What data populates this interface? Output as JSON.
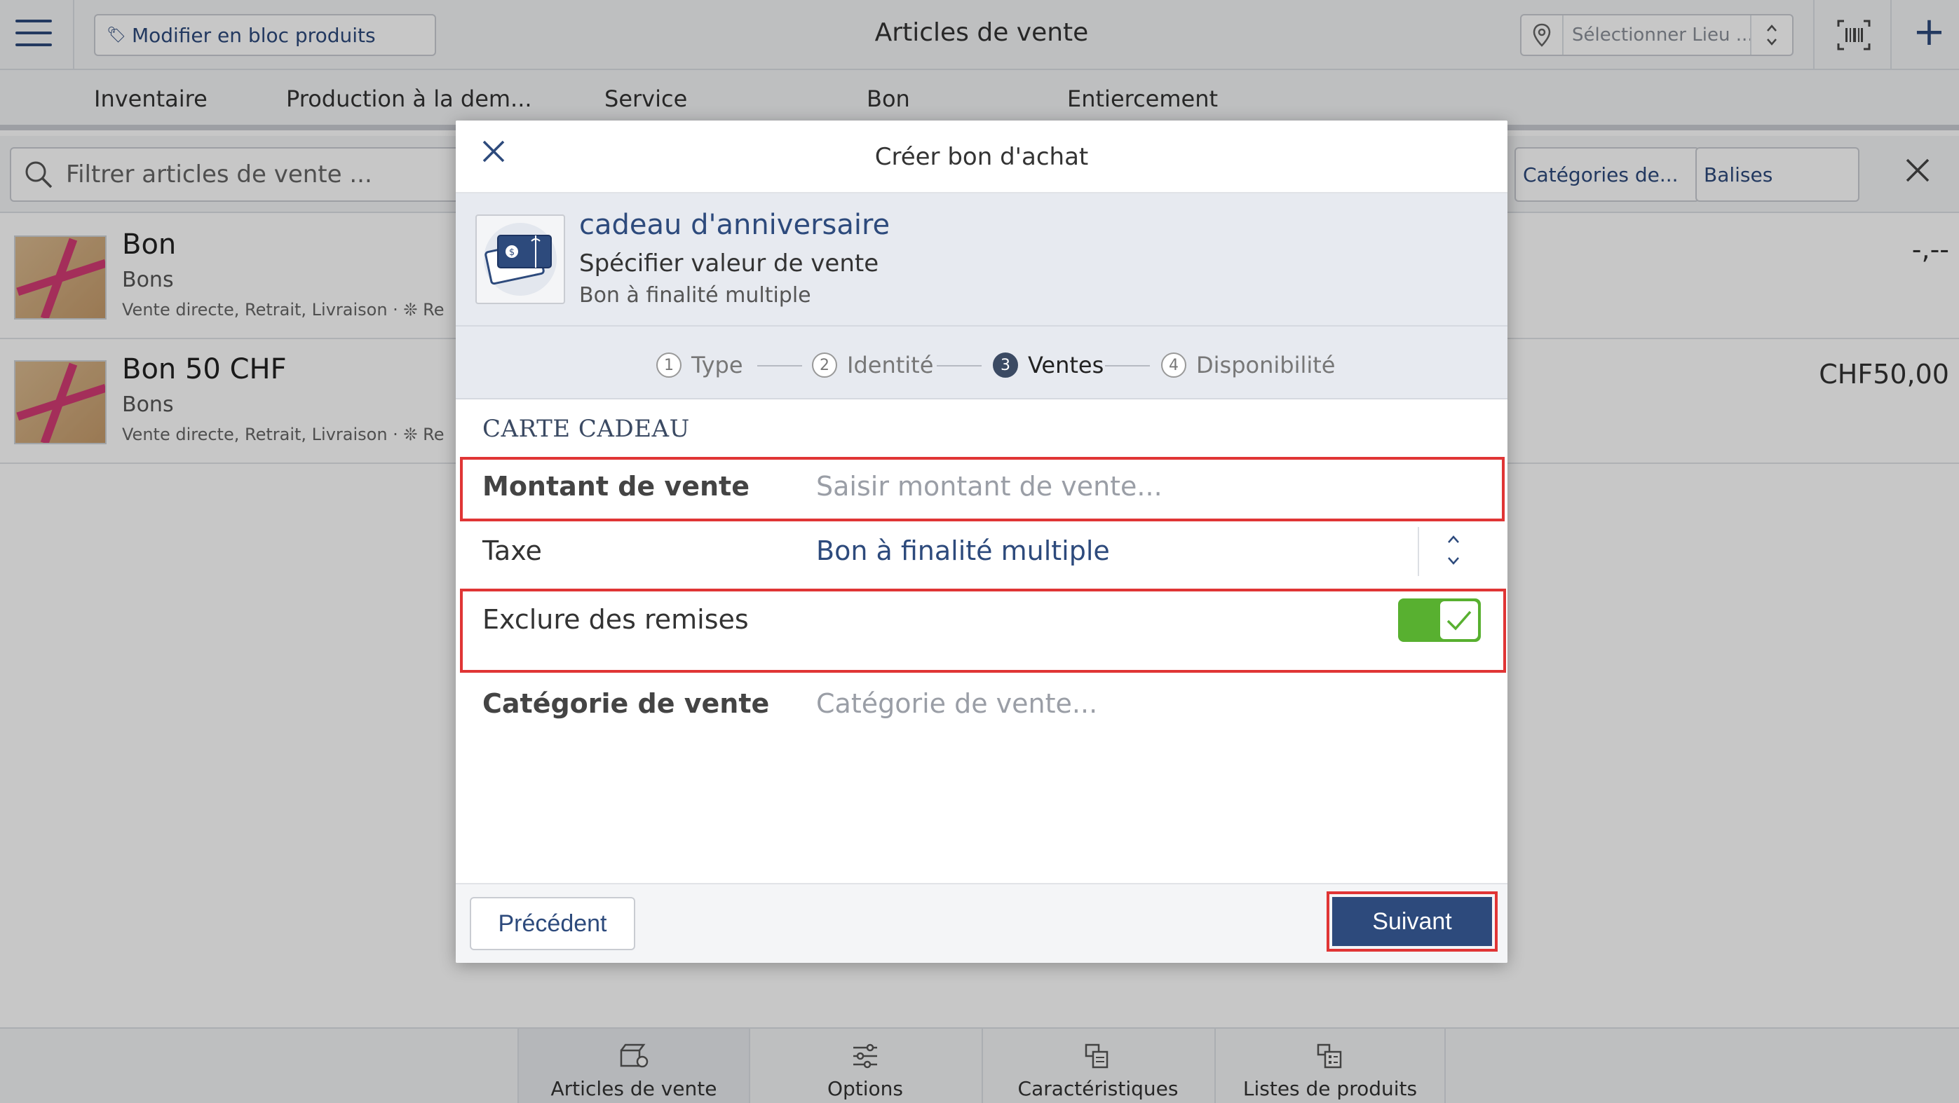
{
  "header": {
    "bulk_edit_label": "Modifier en bloc produits",
    "title": "Articles de vente",
    "location_placeholder": "Sélectionner Lieu ....."
  },
  "tabs": [
    {
      "label": "Inventaire"
    },
    {
      "label": "Production à la dem..."
    },
    {
      "label": "Service"
    },
    {
      "label": "Bon"
    },
    {
      "label": "Entiercement"
    }
  ],
  "filter": {
    "placeholder": "Filtrer articles de vente ...",
    "categories_label": "Catégories de...",
    "tags_label": "Balises"
  },
  "list": [
    {
      "title": "Bon",
      "subtitle": "Bons",
      "meta": "Vente directe, Retrait, Livraison · ❊ Re",
      "price": "-,--"
    },
    {
      "title": "Bon 50 CHF",
      "subtitle": "Bons",
      "meta": "Vente directe, Retrait, Livraison · ❊ Re",
      "price": "CHF50,00"
    }
  ],
  "bottom_nav": [
    {
      "label": "Articles de vente",
      "active": true
    },
    {
      "label": "Options",
      "active": false
    },
    {
      "label": "Caractéristiques",
      "active": false
    },
    {
      "label": "Listes de produits",
      "active": false
    }
  ],
  "modal": {
    "title": "Créer bon d'achat",
    "product": {
      "name": "cadeau d'anniversaire",
      "subtitle": "Spécifier valeur de vente",
      "type": "Bon à finalité multiple"
    },
    "steps": [
      {
        "num": "1",
        "label": "Type",
        "active": false
      },
      {
        "num": "2",
        "label": "Identité",
        "active": false
      },
      {
        "num": "3",
        "label": "Ventes",
        "active": true
      },
      {
        "num": "4",
        "label": "Disponibilité",
        "active": false
      }
    ],
    "section_title": "CARTE CADEAU",
    "fields": {
      "amount": {
        "label": "Montant de vente",
        "placeholder": "Saisir montant de vente..."
      },
      "tax": {
        "label": "Taxe",
        "value": "Bon à finalité multiple"
      },
      "exclude_discounts": {
        "label": "Exclure des remises",
        "checked": true
      },
      "sales_category": {
        "label": "Catégorie de vente",
        "placeholder": "Catégorie de vente..."
      }
    },
    "footer": {
      "prev_label": "Précédent",
      "next_label": "Suivant"
    }
  },
  "colors": {
    "accent": "#2d4a7c",
    "toggle_on": "#58b030",
    "highlight": "#e03535"
  }
}
